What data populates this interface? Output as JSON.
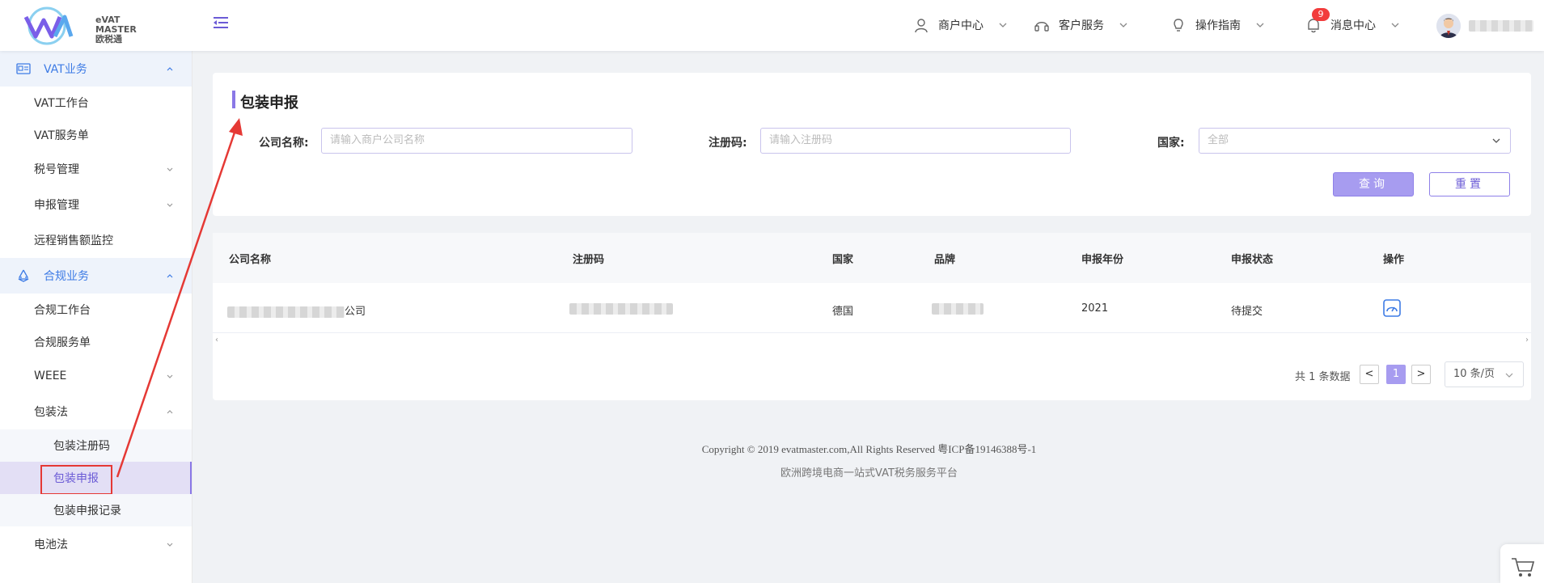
{
  "header": {
    "logo_text_1": "eVAT",
    "logo_text_2": "MASTER",
    "logo_text_3": "欧税通",
    "nav": [
      {
        "label": "商户中心",
        "icon": "user-icon"
      },
      {
        "label": "客户服务",
        "icon": "headset-icon"
      },
      {
        "label": "操作指南",
        "icon": "lightbulb-icon"
      },
      {
        "label": "消息中心",
        "icon": "bell-icon"
      }
    ],
    "message_badge": "9"
  },
  "sidebar": {
    "groups": [
      {
        "label": "VAT业务",
        "icon": "id-card-icon"
      },
      {
        "label": "合规业务",
        "icon": "recycle-icon"
      }
    ],
    "items": {
      "vat_workbench": "VAT工作台",
      "vat_orders": "VAT服务单",
      "tax_mgmt": "税号管理",
      "filing_mgmt": "申报管理",
      "remote_sales": "远程销售额监控",
      "compliance_workbench": "合规工作台",
      "compliance_orders": "合规服务单",
      "weee": "WEEE",
      "packaging_law": "包装法",
      "pkg_register": "包装注册码",
      "pkg_filing": "包装申报",
      "pkg_records": "包装申报记录",
      "battery_law": "电池法"
    }
  },
  "main": {
    "title": "包装申报",
    "form": {
      "company_label": "公司名称:",
      "company_placeholder": "请输入商户公司名称",
      "reg_label": "注册码:",
      "reg_placeholder": "请输入注册码",
      "country_label": "国家:",
      "country_value": "全部",
      "query_button": "查询",
      "reset_button": "重置"
    },
    "table": {
      "headers": [
        "公司名称",
        "注册码",
        "国家",
        "品牌",
        "申报年份",
        "申报状态",
        "操作"
      ],
      "rows": [
        {
          "company_suffix": "公司",
          "country": "德国",
          "year": "2021",
          "status": "待提交"
        }
      ]
    },
    "pagination": {
      "total": "共 1 条数据",
      "prev": "<",
      "page": "1",
      "next": ">",
      "page_size": "10 条/页"
    }
  },
  "footer": {
    "copyright": "Copyright © 2019 evatmaster.com,All Rights Reserved 粤ICP备19146388号-1",
    "tagline": "欧洲跨境电商一站式VAT税务服务平台"
  },
  "colors": {
    "accent": "#8a78e6",
    "sidebar_group": "#3d7be5",
    "annotation_red": "#e53935"
  }
}
